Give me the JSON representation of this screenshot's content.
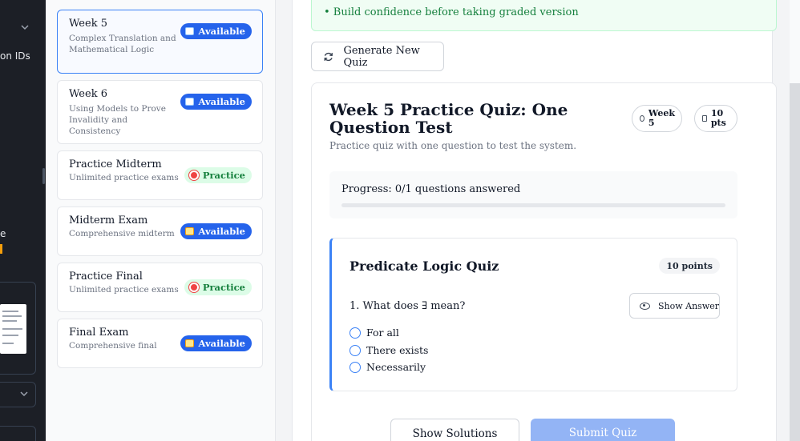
{
  "sidebar_fragments": {
    "line1": "on IDs",
    "line2": "e"
  },
  "weeks": [
    {
      "title": "Week 5",
      "subtitle": "Complex Translation and Mathematical Logic",
      "badge": "Available",
      "badge_type": "available",
      "icon": "book-icon"
    },
    {
      "title": "Week 6",
      "subtitle": "Using Models to Prove Invalidity and Consistency",
      "badge": "Available",
      "badge_type": "available",
      "icon": "book-icon"
    },
    {
      "title": "Practice Midterm",
      "subtitle": "Unlimited practice exams",
      "badge": "Practice",
      "badge_type": "practice",
      "icon": "target-icon"
    },
    {
      "title": "Midterm Exam",
      "subtitle": "Comprehensive midterm",
      "badge": "Available",
      "badge_type": "available",
      "icon": "memo-icon"
    },
    {
      "title": "Practice Final",
      "subtitle": "Unlimited practice exams",
      "badge": "Practice",
      "badge_type": "practice",
      "icon": "target-icon"
    },
    {
      "title": "Final Exam",
      "subtitle": "Comprehensive final",
      "badge": "Available",
      "badge_type": "available",
      "icon": "memo-icon"
    }
  ],
  "tip": "• Build confidence before taking graded version",
  "generate_label": "Generate New Quiz",
  "quiz": {
    "title": "Week 5 Practice Quiz: One Question Test",
    "description": "Practice quiz with one question to test the system.",
    "week_pill": "Week 5",
    "points_pill": "10 pts",
    "progress_label": "Progress: 0/1 questions answered",
    "progress_fraction": 0
  },
  "question": {
    "section_title": "Predicate Logic Quiz",
    "points": "10 points",
    "text": "1. What does ∃ mean?",
    "show_answer_label": "Show Answer",
    "options": [
      "For all",
      "There exists",
      "Necessarily"
    ]
  },
  "actions": {
    "show_solutions": "Show Solutions",
    "submit": "Submit Quiz"
  },
  "colors": {
    "accent": "#2563eb",
    "practice_bg": "#dcfce7",
    "practice_text": "#15803d"
  }
}
